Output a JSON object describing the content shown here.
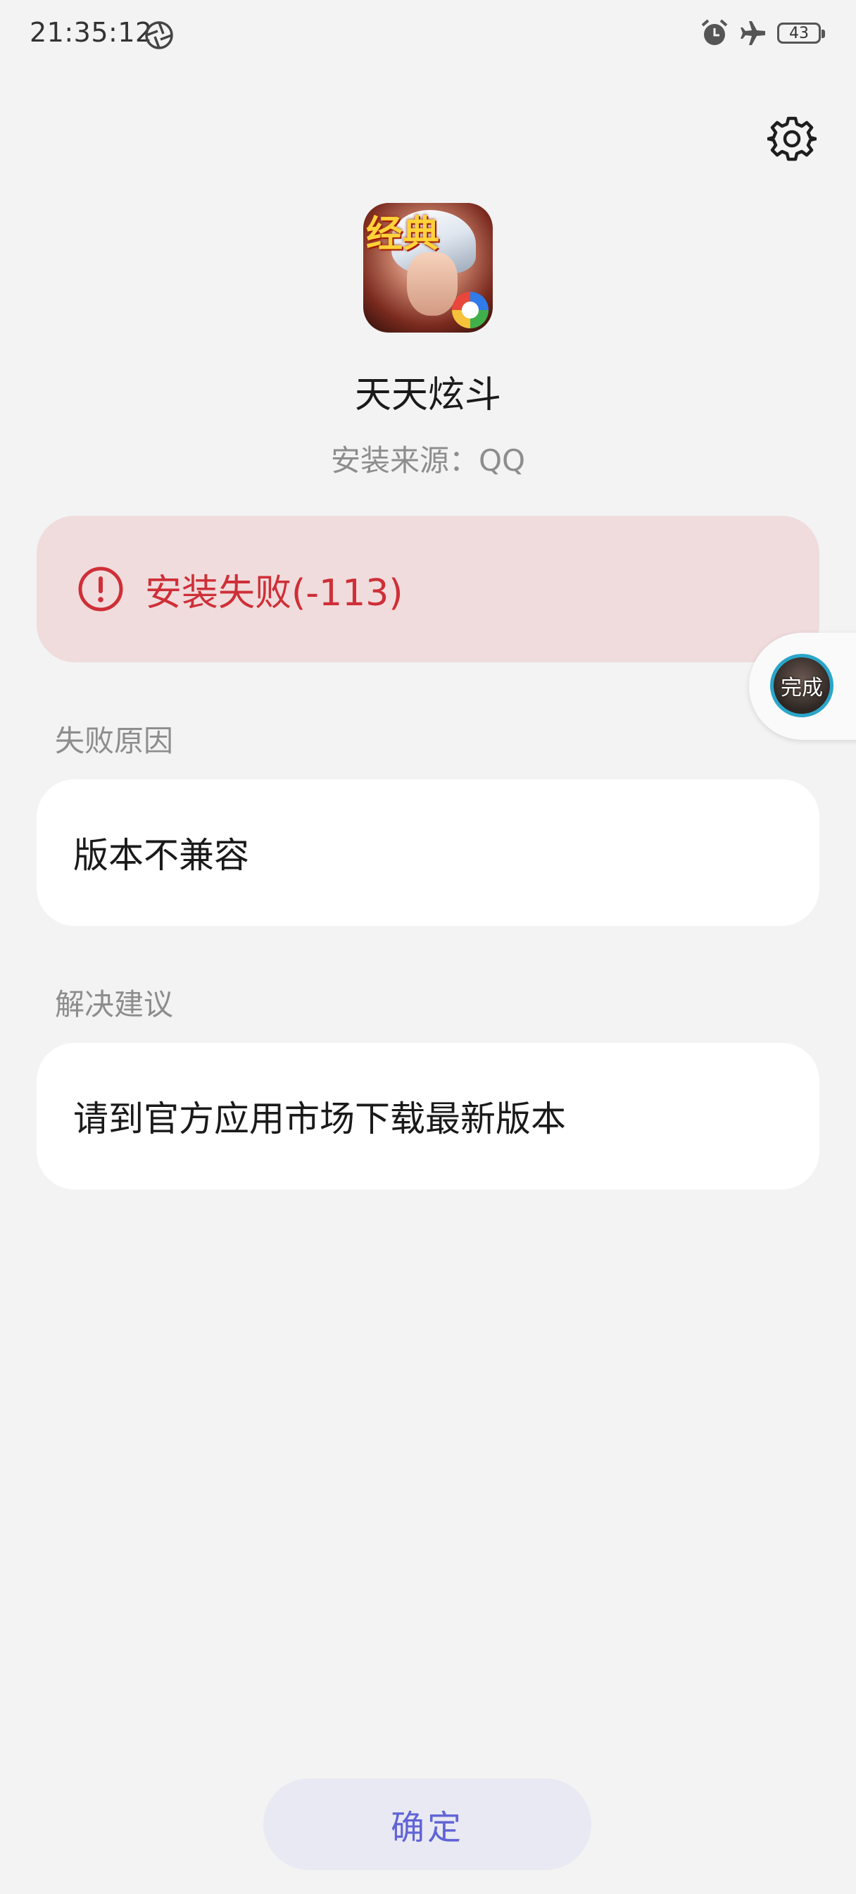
{
  "status_bar": {
    "time": "21:35:12",
    "battery": "43",
    "icons": [
      "shutter-icon",
      "alarm-icon",
      "airplane-mode-icon",
      "battery-icon"
    ]
  },
  "app": {
    "name": "天天炫斗",
    "source": "安装来源：QQ",
    "icon_badge": "经典"
  },
  "error": {
    "message": "安装失败(-113)",
    "color": "#cf2f37",
    "background": "#f0dcdd"
  },
  "floating_bubble": {
    "label": "完成"
  },
  "failure": {
    "label": "失败原因",
    "value": "版本不兼容"
  },
  "suggestion": {
    "label": "解决建议",
    "value": "请到官方应用市场下载最新版本"
  },
  "confirm_button": {
    "label": "确定",
    "color": "#6164d6"
  }
}
